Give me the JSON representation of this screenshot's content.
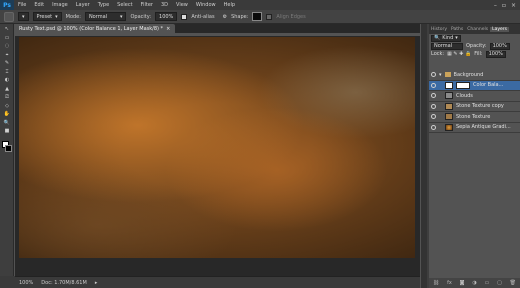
{
  "app": {
    "logo": "Ps"
  },
  "menu": [
    "File",
    "Edit",
    "Image",
    "Layer",
    "Type",
    "Select",
    "Filter",
    "3D",
    "View",
    "Window",
    "Help"
  ],
  "window_controls": [
    "–",
    "▫",
    "×"
  ],
  "options": {
    "preset": "Preset",
    "mode_label": "Mode:",
    "mode_value": "Normal",
    "opacity_label": "Opacity:",
    "opacity_value": "100%",
    "antialias_label": "Anti-alias",
    "shape_label": "Shape:",
    "align_label": "Align Edges"
  },
  "tools": [
    "↖",
    "▭",
    "◌",
    "⌖",
    "✎",
    "⌶",
    "◐",
    "▲",
    "⎚",
    "◇",
    "✋",
    "🔍",
    "■"
  ],
  "document": {
    "tab_title": "Rusty Text.psd @ 100% (Color Balance 1, Layer Mask/8) *",
    "zoom": "100%",
    "doc_info": "Doc: 1.70M/8.61M"
  },
  "panel": {
    "tabs": [
      "History",
      "Paths",
      "Channels",
      "Layers"
    ],
    "active_tab": "Layers",
    "kind_label": "Kind",
    "blend_mode": "Normal",
    "opacity_label": "Opacity:",
    "opacity_value": "100%",
    "lock_label": "Lock:",
    "fill_label": "Fill:",
    "fill_value": "100%",
    "layers": [
      {
        "name": "Background",
        "type": "group"
      },
      {
        "name": "Color Bala...",
        "type": "adjustment",
        "selected": true
      },
      {
        "name": "Clouds",
        "type": "layer"
      },
      {
        "name": "Stone Texture copy",
        "type": "layer"
      },
      {
        "name": "Stone Texture",
        "type": "layer"
      },
      {
        "name": "Sepia Antique Gradi...",
        "type": "layer"
      }
    ],
    "footer_icons": [
      "link-icon",
      "fx-icon",
      "mask-icon",
      "adjust-icon",
      "folder-icon",
      "new-layer-icon",
      "trash-icon"
    ]
  },
  "colors": {
    "accent": "#3b6aa3",
    "image_dark": "#1a120a",
    "image_rust": "#d6822e"
  }
}
